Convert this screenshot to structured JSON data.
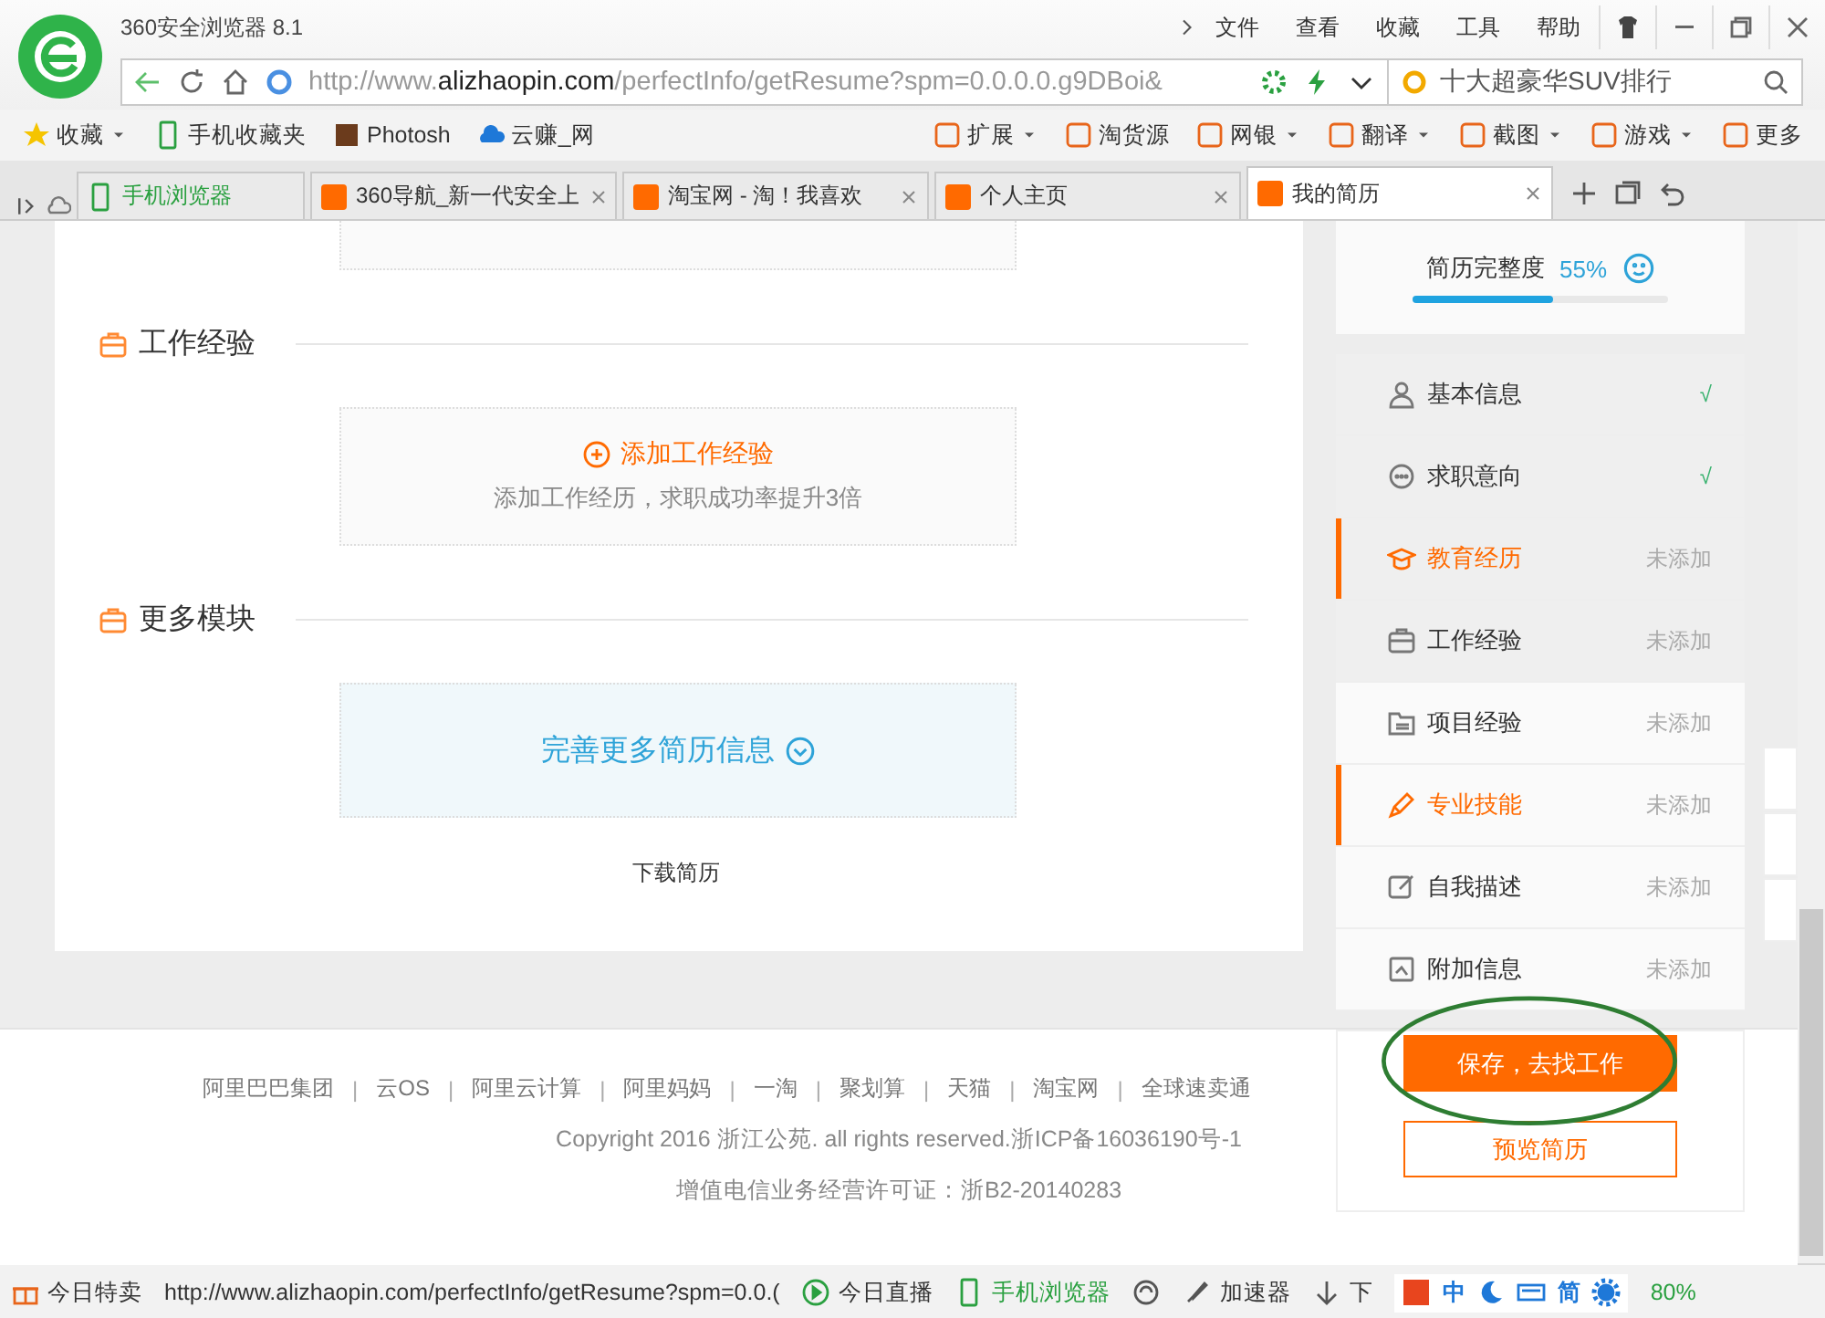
{
  "window": {
    "title": "360安全浏览器 8.1",
    "menu": [
      "文件",
      "查看",
      "收藏",
      "工具",
      "帮助"
    ]
  },
  "address_bar": {
    "url": "http://www.**alizhaopin.com**/perfectInfo/getResume?spm=0.0.0.0.g9DBoi&",
    "search": "十大超豪华SUV排行"
  },
  "bookmarks": {
    "left": [
      {
        "label": "收藏",
        "dropdown": true
      },
      {
        "label": "手机收藏夹",
        "dropdown": false
      },
      {
        "label": "Photosh",
        "dropdown": false
      },
      {
        "label": "云赚_网",
        "dropdown": false
      }
    ],
    "right": [
      {
        "label": "扩展",
        "dropdown": true
      },
      {
        "label": "淘货源",
        "dropdown": false
      },
      {
        "label": "网银",
        "dropdown": true
      },
      {
        "label": "翻译",
        "dropdown": true
      },
      {
        "label": "截图",
        "dropdown": true
      },
      {
        "label": "游戏",
        "dropdown": true
      },
      {
        "label": "更多",
        "dropdown": false
      }
    ]
  },
  "tabs": [
    {
      "label": "手机浏览器",
      "selected": false,
      "closable": false
    },
    {
      "label": "360导航_新一代安全上",
      "selected": false,
      "closable": true
    },
    {
      "label": "淘宝网 - 淘！我喜欢",
      "selected": false,
      "closable": true
    },
    {
      "label": "个人主页",
      "selected": false,
      "closable": true
    },
    {
      "label": "我的简历",
      "selected": true,
      "closable": true
    }
  ],
  "sections": [
    {
      "kind": "add",
      "title": "工作经验",
      "action": "添加工作经验",
      "hint": "添加工作经历，求职成功率提升3倍"
    },
    {
      "kind": "more",
      "title": "更多模块",
      "action": "完善更多简历信息"
    }
  ],
  "download": "下载简历",
  "sidebar": {
    "label": "简历完整度",
    "percent": "55%",
    "level": 0.55,
    "items": [
      {
        "label": "基本信息",
        "status": "√",
        "done": true,
        "selected": false
      },
      {
        "label": "求职意向",
        "status": "√",
        "done": true,
        "selected": false
      },
      {
        "label": "教育经历",
        "status": "未添加",
        "done": false,
        "selected": true
      },
      {
        "label": "工作经验",
        "status": "未添加",
        "done": false,
        "selected": false
      },
      {
        "label": "项目经验",
        "status": "未添加",
        "done": false,
        "selected": false
      },
      {
        "label": "专业技能",
        "status": "未添加",
        "done": false,
        "selected": true
      },
      {
        "label": "自我描述",
        "status": "未添加",
        "done": false,
        "selected": false
      },
      {
        "label": "附加信息",
        "status": "未添加",
        "done": false,
        "selected": false
      }
    ],
    "save": "保存，去找工作",
    "preview": "预览简历"
  },
  "footer": {
    "links": [
      {
        "kind": "link",
        "label": "阿里巴巴集团"
      },
      {
        "kind": "separator",
        "label": "|"
      },
      {
        "kind": "link",
        "label": "云OS"
      },
      {
        "kind": "separator",
        "label": "|"
      },
      {
        "kind": "link",
        "label": "阿里云计算"
      },
      {
        "kind": "separator",
        "label": "|"
      },
      {
        "kind": "link",
        "label": "阿里妈妈"
      },
      {
        "kind": "separator",
        "label": "|"
      },
      {
        "kind": "link",
        "label": "一淘"
      },
      {
        "kind": "separator",
        "label": "|"
      },
      {
        "kind": "link",
        "label": "聚划算"
      },
      {
        "kind": "separator",
        "label": "|"
      },
      {
        "kind": "link",
        "label": "天猫"
      },
      {
        "kind": "separator",
        "label": "|"
      },
      {
        "kind": "link",
        "label": "淘宝网"
      },
      {
        "kind": "separator",
        "label": "|"
      },
      {
        "kind": "link",
        "label": "全球速卖通"
      }
    ],
    "copyright": "Copyright 2016 浙江公苑. all rights reserved.浙ICP备16036190号-1",
    "license": "增值电信业务经营许可证：浙B2-20140283"
  },
  "status_bar": {
    "deal": "今日特卖",
    "url": "http://www.alizhaopin.com/perfectInfo/getResume?spm=0.0.(",
    "live": "今日直播",
    "mobile": "手机浏览器",
    "accelerator": "加速器",
    "download": "下",
    "ime": "中",
    "simplified": "简",
    "zoom": "80%"
  }
}
